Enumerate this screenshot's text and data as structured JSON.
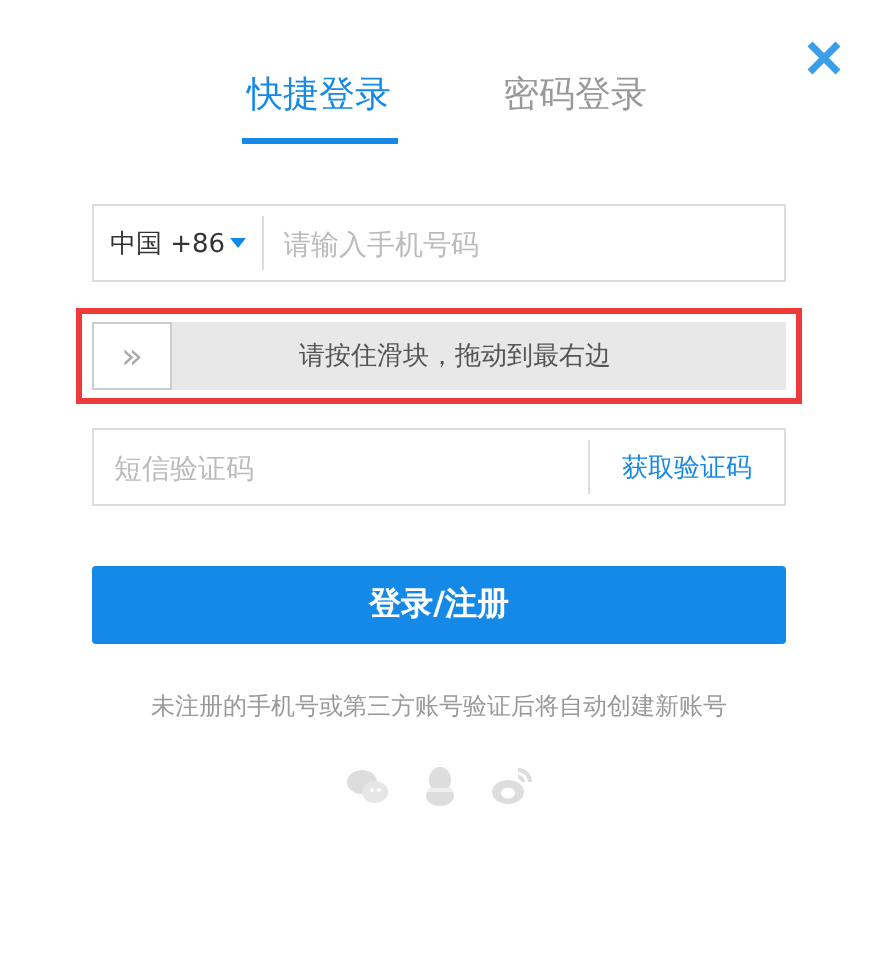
{
  "tabs": [
    {
      "label": "快捷登录",
      "selected": true
    },
    {
      "label": "密码登录",
      "selected": false
    }
  ],
  "phone": {
    "country": "中国 +86",
    "placeholder": "请输入手机号码"
  },
  "slider": {
    "handle": "»",
    "label": "请按住滑块，拖动到最右边",
    "level": 0,
    "highlighted": true
  },
  "sms": {
    "placeholder": "短信验证码",
    "action": "获取验证码"
  },
  "submit": "登录/注册",
  "note": "未注册的手机号或第三方账号验证后将自动创建新账号",
  "social": [
    {
      "kind": "wechat"
    },
    {
      "kind": "qq"
    },
    {
      "kind": "weibo"
    }
  ]
}
